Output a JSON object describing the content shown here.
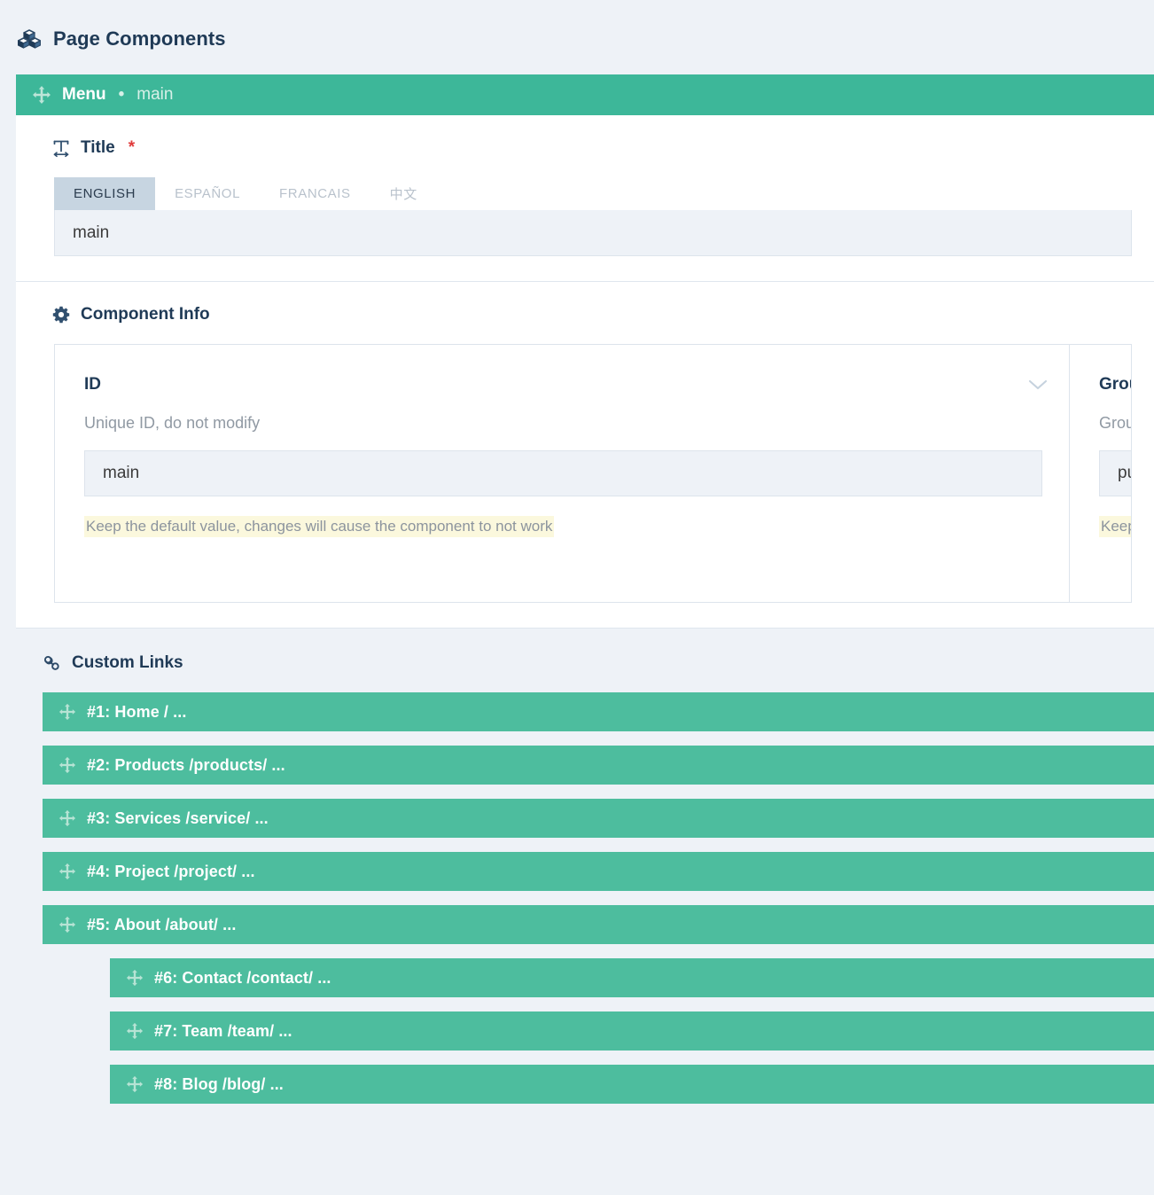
{
  "header": {
    "icon": "cubes-icon",
    "title": "Page Components"
  },
  "component": {
    "drag_icon": "move-icon",
    "name": "Menu",
    "separator": "•",
    "subtitle": "main"
  },
  "title_field": {
    "icon": "text-width-icon",
    "label": "Title",
    "required_marker": "*",
    "tabs": [
      {
        "label": "ENGLISH",
        "active": true
      },
      {
        "label": "ESPAÑOL",
        "active": false
      },
      {
        "label": "FRANCAIS",
        "active": false
      },
      {
        "label": "中文",
        "active": false
      }
    ],
    "value": "main"
  },
  "component_info": {
    "icon": "gear-icon",
    "label": "Component Info",
    "collapse_icon": "chevron-down-icon",
    "fields": [
      {
        "label": "ID",
        "description": "Unique ID, do not modify",
        "value": "main",
        "help": "Keep the default value, changes will cause the component to not work"
      },
      {
        "label": "Group",
        "description": "Group n",
        "value": "public",
        "help": "Keep the"
      }
    ]
  },
  "custom_links": {
    "icon": "link-icon",
    "label": "Custom Links",
    "items": [
      {
        "label": "#1: Home / ...",
        "depth": 0
      },
      {
        "label": "#2: Products /products/ ...",
        "depth": 0
      },
      {
        "label": "#3: Services /service/ ...",
        "depth": 0
      },
      {
        "label": "#4: Project /project/ ...",
        "depth": 0
      },
      {
        "label": "#5: About /about/ ...",
        "depth": 0
      },
      {
        "label": "#6: Contact /contact/ ...",
        "depth": 1
      },
      {
        "label": "#7: Team /team/ ...",
        "depth": 1
      },
      {
        "label": "#8: Blog /blog/ ...",
        "depth": 1
      }
    ]
  },
  "colors": {
    "accent_teal": "#3db799",
    "link_teal": "#4dbd9e",
    "page_bg": "#eef2f7",
    "heading": "#1f3a56",
    "required_red": "#e03b3b",
    "help_highlight": "#fbf8dd"
  }
}
